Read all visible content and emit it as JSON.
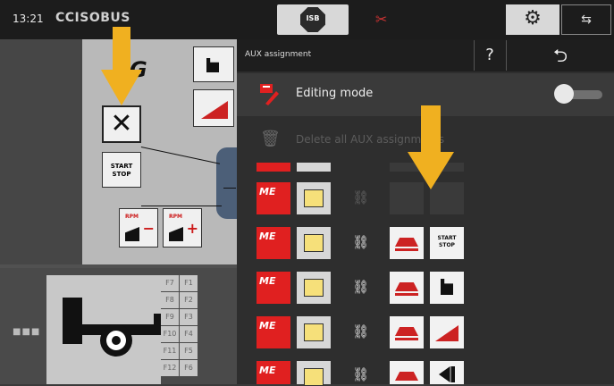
{
  "status": {
    "time": "13:21",
    "brand": "CCISOBUS",
    "isb_label": "ISB"
  },
  "panel": {
    "title": "AUX assignment",
    "help_label": "?",
    "back_label": "⮌",
    "editing_mode_label": "Editing mode",
    "editing_mode_on": false,
    "delete_all_label": "Delete all AUX assignments"
  },
  "left": {
    "logo_text": "G",
    "start_stop_label": "START\nSTOP",
    "rpm_label": "RPM"
  },
  "fkeys": [
    "F7",
    "F1",
    "F8",
    "F2",
    "F9",
    "F3",
    "F10",
    "F4",
    "F11",
    "F5",
    "F12",
    "F6"
  ],
  "aux_rows": [
    {
      "linked": false,
      "functions": []
    },
    {
      "linked": true,
      "functions": [
        "spread",
        "start-stop"
      ]
    },
    {
      "linked": true,
      "functions": [
        "spread",
        "flag"
      ]
    },
    {
      "linked": true,
      "functions": [
        "spread",
        "wedge"
      ]
    },
    {
      "linked": true,
      "functions": [
        "spread",
        "play"
      ]
    }
  ],
  "colors": {
    "accent_red": "#e02020",
    "arrow": "#f0b020",
    "panel_bg": "#2e2e2e"
  }
}
